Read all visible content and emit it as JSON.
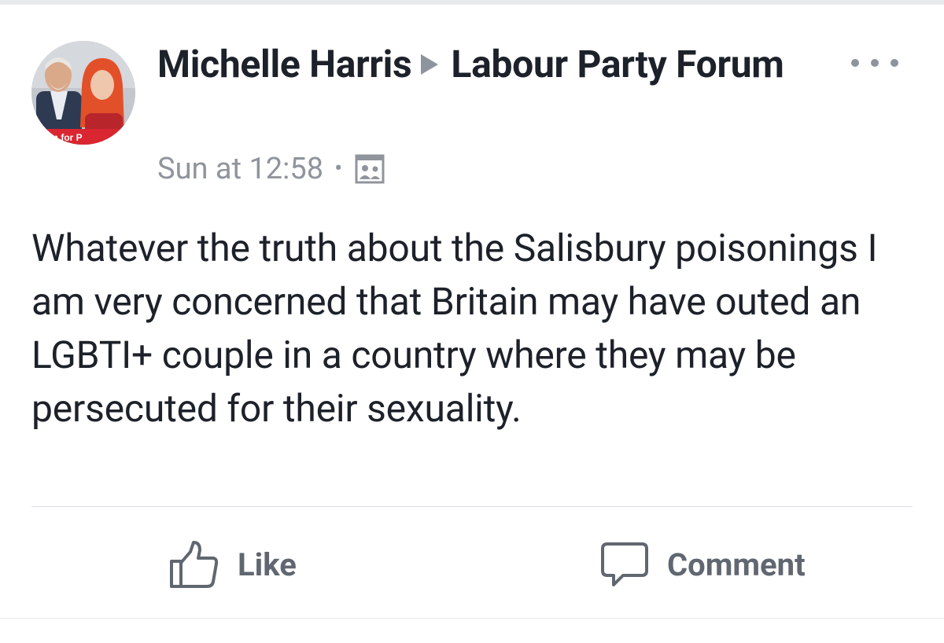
{
  "post": {
    "author": "Michelle Harris",
    "group": "Labour Party Forum",
    "timestamp": "Sun at 12:58",
    "separator": "•",
    "privacy_icon": "photo-audience-icon",
    "text": "Whatever the truth about the Salisbury poisonings I am very concerned that Britain may have outed an LGBTI+ couple in a country where they may be persecuted for their sexuality.",
    "avatar_banner_text": "rbyn for P"
  },
  "actions": {
    "like_label": "Like",
    "comment_label": "Comment"
  },
  "colors": {
    "text_primary": "#1d2129",
    "text_secondary": "#90949c",
    "action_gray": "#606770",
    "banner_red": "#d92630"
  }
}
